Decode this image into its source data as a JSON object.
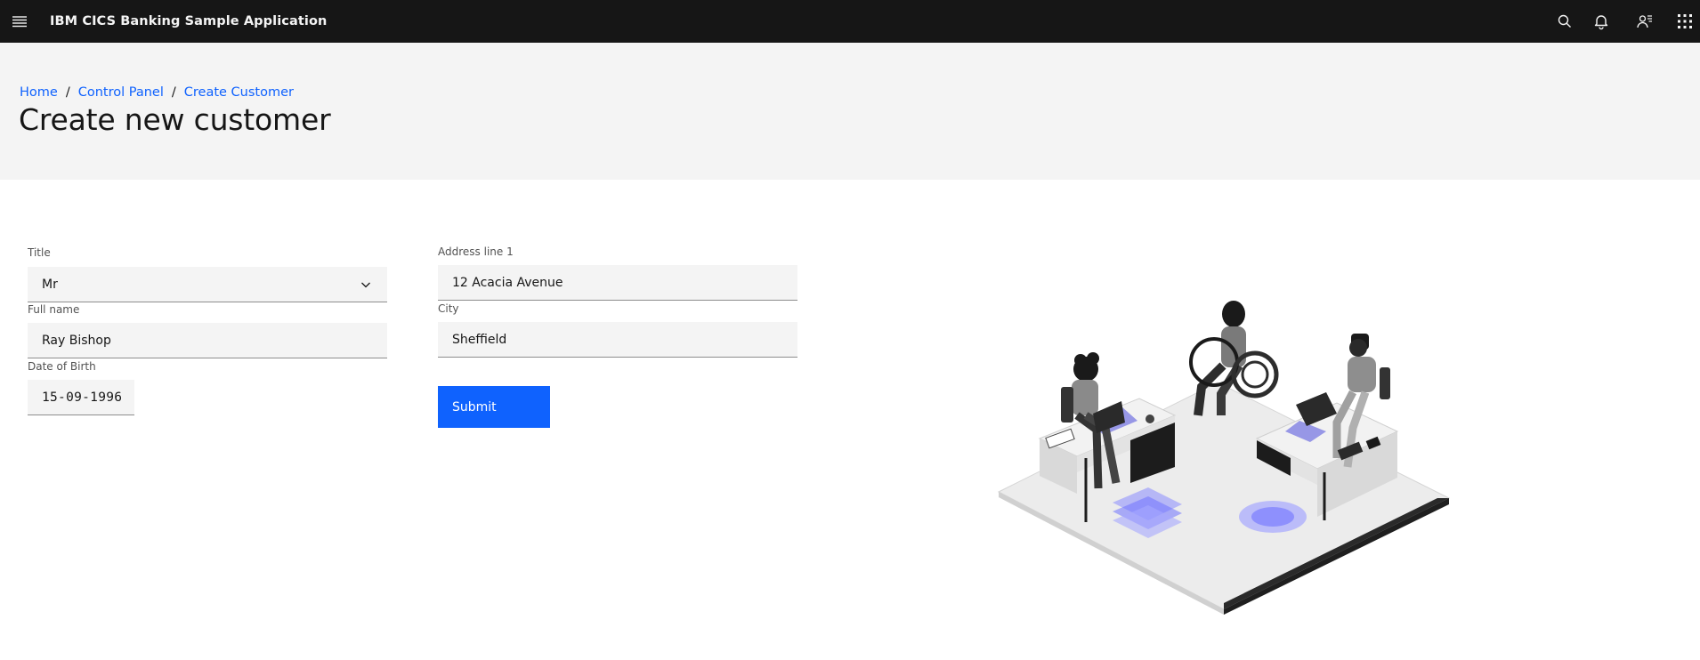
{
  "header": {
    "app_name": "IBM CICS Banking Sample Application",
    "icons": [
      "menu-icon",
      "search-icon",
      "notification-icon",
      "user-switcher-icon",
      "app-switcher-icon"
    ]
  },
  "breadcrumb": [
    {
      "label": "Home"
    },
    {
      "label": "Control Panel"
    },
    {
      "label": "Create Customer"
    }
  ],
  "breadcrumb_separator": "/",
  "page_title": "Create new customer",
  "form": {
    "title": {
      "label": "Title",
      "value": "Mr"
    },
    "full_name": {
      "label": "Full name",
      "value": "Ray Bishop"
    },
    "dob": {
      "label": "Date of Birth",
      "value": "15-09-1996"
    },
    "address_line_1": {
      "label": "Address line 1",
      "value": "12 Acacia Avenue"
    },
    "city": {
      "label": "City",
      "value": "Sheffield"
    },
    "submit_label": "Submit"
  },
  "colors": {
    "header_bg": "#161616",
    "hero_bg": "#f4f4f4",
    "accent": "#0f62fe",
    "field_bg": "#f4f4f4"
  }
}
